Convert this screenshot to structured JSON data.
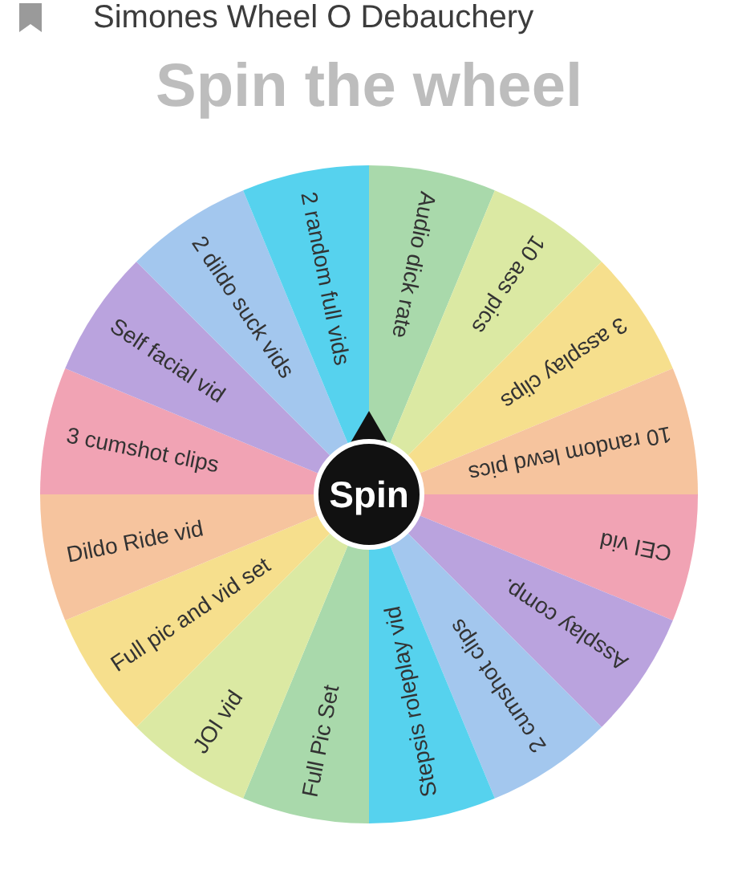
{
  "header": {
    "title": "Simones Wheel O Debauchery"
  },
  "heading": "Spin the wheel",
  "wheel": {
    "spin_label": "Spin",
    "segments": [
      {
        "label": "Audio dick rate",
        "color": "#a9d9ab"
      },
      {
        "label": "10 ass pics",
        "color": "#dbe9a3"
      },
      {
        "label": "3 assplay clips",
        "color": "#f6df8d"
      },
      {
        "label": "10 random lewd pics",
        "color": "#f6c49e"
      },
      {
        "label": "CEI vid",
        "color": "#f1a3b4"
      },
      {
        "label": "Assplay comp.",
        "color": "#baa3de"
      },
      {
        "label": "2 cumshot clips",
        "color": "#a3c7ee"
      },
      {
        "label": "Stepsis roleplay vid",
        "color": "#56d2ee"
      },
      {
        "label": "Full Pic Set",
        "color": "#a9d9ab"
      },
      {
        "label": "JOI vid",
        "color": "#dbe9a3"
      },
      {
        "label": "Full pic and vid set",
        "color": "#f6df8d"
      },
      {
        "label": "Dildo Ride vid",
        "color": "#f6c49e"
      },
      {
        "label": "3 cumshot clips",
        "color": "#f1a3b4"
      },
      {
        "label": "Self facial vid",
        "color": "#baa3de"
      },
      {
        "label": "2 dildo suck vids",
        "color": "#a3c7ee"
      },
      {
        "label": "2 random full vids",
        "color": "#56d2ee"
      }
    ]
  }
}
